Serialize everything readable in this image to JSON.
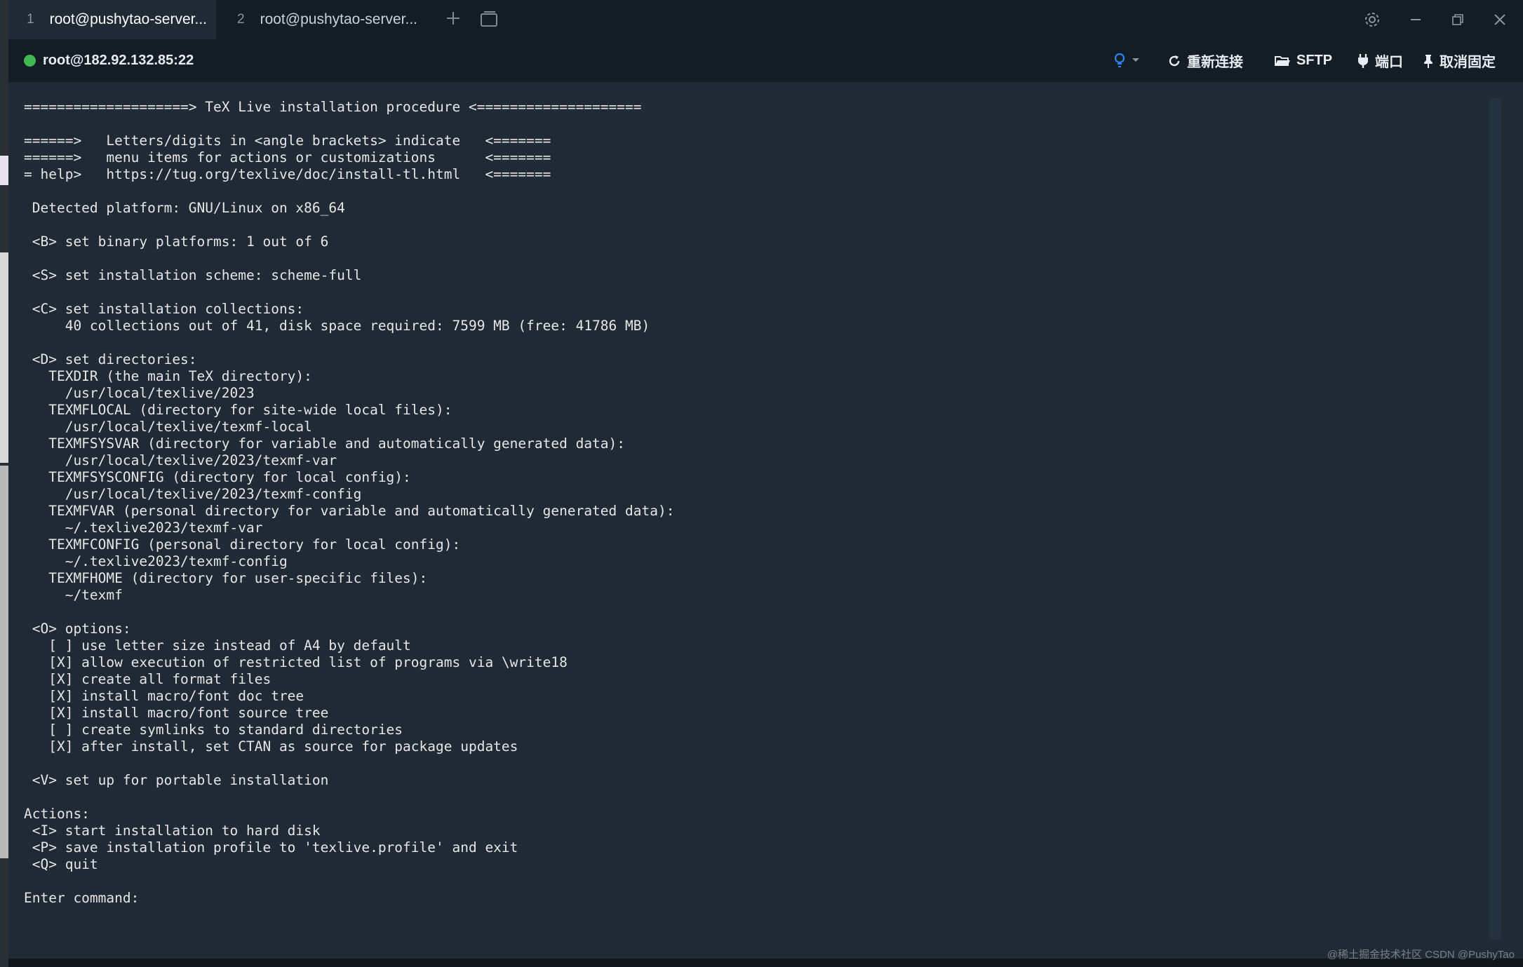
{
  "tabs": [
    {
      "number": "1",
      "title": "root@pushytao-server..."
    },
    {
      "number": "2",
      "title": "root@pushytao-server..."
    }
  ],
  "session": {
    "host": "root@182.92.132.85:22",
    "status_color": "#3fb950",
    "buttons": {
      "reconnect": "重新连接",
      "sftp": "SFTP",
      "port": "端口",
      "unpin": "取消固定"
    }
  },
  "icons": {
    "add_tab": "plus-icon",
    "tab_list": "window-list-icon",
    "settings": "gear-icon",
    "minimize": "minimize-icon",
    "restore": "restore-icon",
    "close": "close-icon",
    "hint": "lightbulb-icon",
    "reconnect": "refresh-icon",
    "sftp": "folder-icon",
    "port": "plug-icon",
    "unpin": "pin-icon"
  },
  "terminal": {
    "output": "====================> TeX Live installation procedure <====================\n\n======>   Letters/digits in <angle brackets> indicate   <=======\n======>   menu items for actions or customizations      <=======\n= help>   https://tug.org/texlive/doc/install-tl.html   <=======\n\n Detected platform: GNU/Linux on x86_64\n\n <B> set binary platforms: 1 out of 6\n\n <S> set installation scheme: scheme-full\n\n <C> set installation collections:\n     40 collections out of 41, disk space required: 7599 MB (free: 41786 MB)\n\n <D> set directories:\n   TEXDIR (the main TeX directory):\n     /usr/local/texlive/2023\n   TEXMFLOCAL (directory for site-wide local files):\n     /usr/local/texlive/texmf-local\n   TEXMFSYSVAR (directory for variable and automatically generated data):\n     /usr/local/texlive/2023/texmf-var\n   TEXMFSYSCONFIG (directory for local config):\n     /usr/local/texlive/2023/texmf-config\n   TEXMFVAR (personal directory for variable and automatically generated data):\n     ~/.texlive2023/texmf-var\n   TEXMFCONFIG (personal directory for local config):\n     ~/.texlive2023/texmf-config\n   TEXMFHOME (directory for user-specific files):\n     ~/texmf\n\n <O> options:\n   [ ] use letter size instead of A4 by default\n   [X] allow execution of restricted list of programs via \\write18\n   [X] create all format files\n   [X] install macro/font doc tree\n   [X] install macro/font source tree\n   [ ] create symlinks to standard directories\n   [X] after install, set CTAN as source for package updates\n\n <V> set up for portable installation\n\nActions:\n <I> start installation to hard disk\n <P> save installation profile to 'texlive.profile' and exit\n <Q> quit\n\nEnter command: "
  },
  "watermark": "@稀土掘金技术社区 CSDN @PushyTao"
}
